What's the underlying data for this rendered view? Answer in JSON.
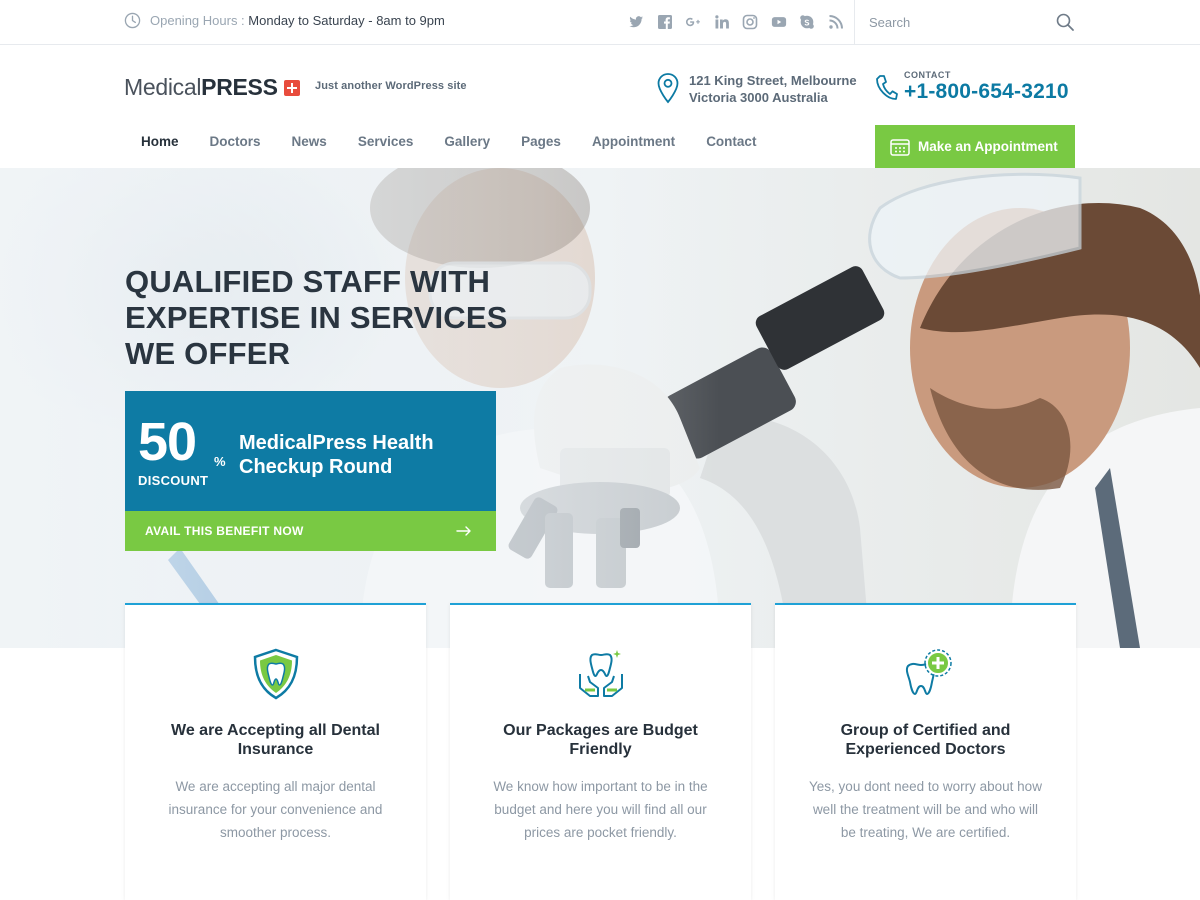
{
  "topbar": {
    "hours_label": "Opening Hours :",
    "hours_value": "Monday to Saturday - 8am to 9pm",
    "social_icons": [
      "twitter-icon",
      "facebook-icon",
      "google-plus-icon",
      "linkedin-icon",
      "instagram-icon",
      "youtube-icon",
      "skype-icon",
      "rss-icon"
    ],
    "search_placeholder": "Search"
  },
  "header": {
    "logo_word1": "Medical",
    "logo_word2": "PRESS",
    "tagline": "Just another WordPress site",
    "address_line1": "121 King Street, Melbourne",
    "address_line2": "Victoria 3000 Australia",
    "contact_label": "CONTACT",
    "phone": "+1-800-654-3210"
  },
  "nav": {
    "items": [
      "Home",
      "Doctors",
      "News",
      "Services",
      "Gallery",
      "Pages",
      "Appointment",
      "Contact"
    ],
    "active": "Home",
    "appointment_button": "Make an Appointment"
  },
  "hero": {
    "title": "QUALIFIED STAFF WITH EXPERTISE IN SERVICES WE OFFER",
    "promo_number": "50",
    "promo_percent": "%",
    "promo_discount": "DISCOUNT",
    "promo_text": "MedicalPress Health Checkup Round",
    "promo_button": "AVAIL THIS BENEFIT NOW"
  },
  "features": [
    {
      "icon": "dental-shield-icon",
      "title": "We are Accepting all Dental Insurance",
      "text": "We are accepting all major dental insurance for your convenience and smoother process."
    },
    {
      "icon": "tooth-hands-icon",
      "title": "Our Packages are Budget Friendly",
      "text": "We know how important to be in the budget and here you will find all our prices are pocket friendly."
    },
    {
      "icon": "tooth-plus-icon",
      "title": "Group of Certified and Experienced Doctors",
      "text": "Yes, you dont need to worry about how well the treatment will be and who will be treating, We are certified."
    }
  ],
  "colors": {
    "brand_blue": "#0e7ba4",
    "accent_green": "#79c943",
    "logo_red": "#e84c3d",
    "card_top_border": "#1fa1d6"
  }
}
